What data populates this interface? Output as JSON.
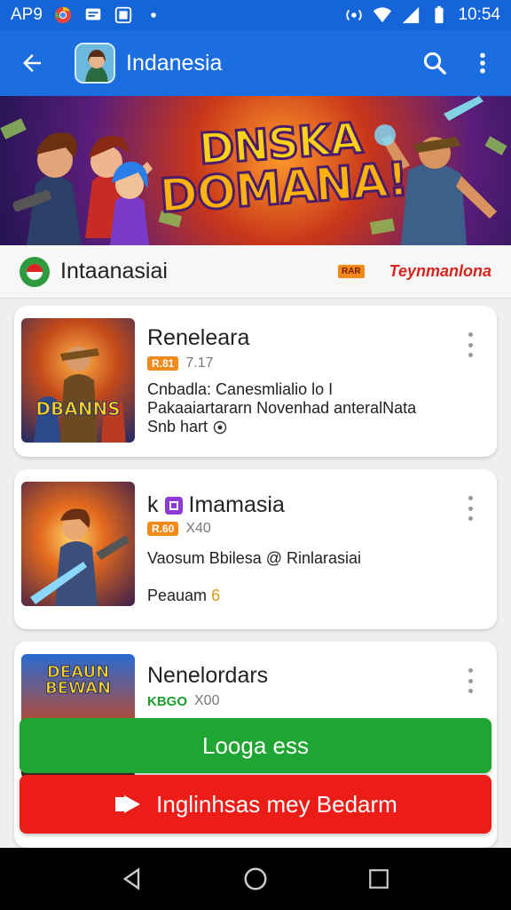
{
  "status_bar": {
    "carrier": "AP9",
    "time": "10:54",
    "icons": [
      "chrome-icon",
      "message-icon",
      "gallery-icon",
      "dot-icon",
      "hotspot-icon",
      "wifi-icon",
      "signal-icon",
      "battery-icon"
    ]
  },
  "app_bar": {
    "title": "Indanesia",
    "icons": [
      "back-arrow-icon",
      "search-icon",
      "more-vert-icon"
    ]
  },
  "banner": {
    "line1": "DNSKA",
    "line2": "DOMANA!"
  },
  "section": {
    "name": "Intaanasiai",
    "tag": "RAR",
    "link": "Teynmanlona"
  },
  "apps": [
    {
      "title": "Reneleara",
      "badge": "R.81",
      "stat": "7.17",
      "desc_line1": "Cnbadla: Canesmlialio lo I",
      "desc_line2": "Pakaaiartararn Novenhad anteralNata",
      "desc_line3": "Snb hart",
      "thumb_label": "DBANNS"
    },
    {
      "title": "Imamasia",
      "badge": "R.60",
      "stat": "X40",
      "desc_line1": "Vaosum Bbilesa @ Rinlarasiai",
      "footer_label": "Peauam",
      "footer_value": "6"
    },
    {
      "title": "Nenelordars",
      "badge": "KBGO",
      "stat": "X00",
      "thumb_label": "DEAUN BEWAN"
    }
  ],
  "buttons": {
    "primary": "Looga ess",
    "secondary": "Inglinhsas mey Bedarm"
  },
  "colors": {
    "primary_blue": "#1a6ee0",
    "green": "#1ea532",
    "red": "#ec1c16",
    "orange_badge": "#f28a1a"
  }
}
